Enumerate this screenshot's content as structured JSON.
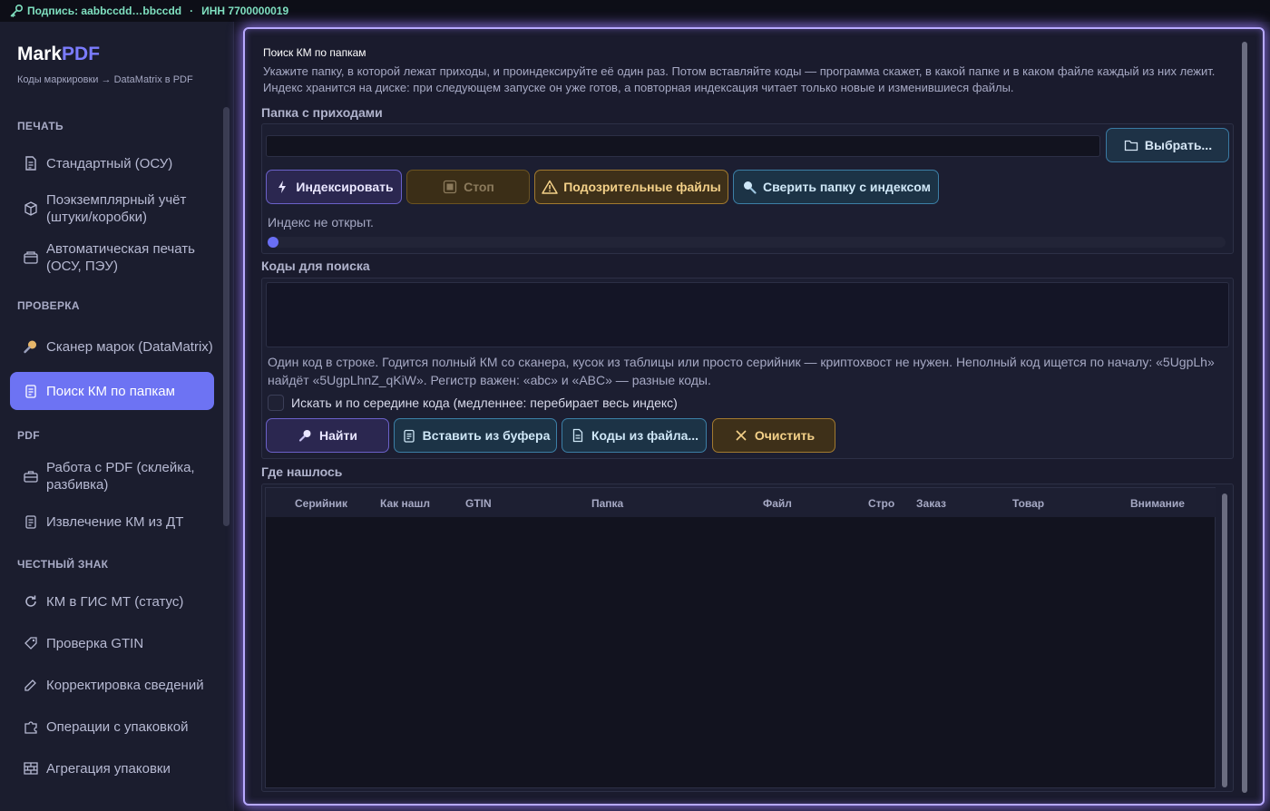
{
  "topbar": {
    "signature": "Подпись: aabbccdd…bbccdd",
    "separator": "·",
    "inn": "ИНН 7700000019"
  },
  "sidebar": {
    "brand_main": "Mark",
    "brand_accent": "PDF",
    "subtitle": "Коды маркировки → DataMatrix в PDF",
    "sections": {
      "print": "ПЕЧАТЬ",
      "check": "ПРОВЕРКА",
      "pdf": "PDF",
      "honest": "ЧЕСТНЫЙ ЗНАК"
    },
    "items": [
      {
        "label": "Стандартный (ОСУ)",
        "icon": "document-icon"
      },
      {
        "label": "Поэкземплярный учёт (штуки/коробки)",
        "icon": "box-icon"
      },
      {
        "label": "Автоматическая печать (ОСУ, ПЭУ)",
        "icon": "printer-icon"
      },
      {
        "label": "Сканер марок (DataMatrix)",
        "icon": "magnifier-icon"
      },
      {
        "label": "Поиск КМ по папкам",
        "icon": "clipboard-icon",
        "active": true
      },
      {
        "label": "Работа с PDF (склейка, разбивка)",
        "icon": "briefcase-icon"
      },
      {
        "label": "Извлечение КМ из ДТ",
        "icon": "clipboard-icon"
      },
      {
        "label": "КМ в ГИС МТ (статус)",
        "icon": "refresh-icon"
      },
      {
        "label": "Проверка GTIN",
        "icon": "tag-icon"
      },
      {
        "label": "Корректировка сведений",
        "icon": "pencil-icon"
      },
      {
        "label": "Операции с упаковкой",
        "icon": "puzzle-icon"
      },
      {
        "label": "Агрегация упаковки",
        "icon": "bricks-icon"
      }
    ]
  },
  "main": {
    "title": "Поиск КМ по папкам",
    "description": "Укажите папку, в которой лежат приходы, и проиндексируйте её один раз. Потом вставляйте коды — программа скажет, в какой папке и в каком файле каждый из них лежит. Индекс хранится на диске: при следующем запуске он уже готов, а повторная индексация читает только новые и изменившиеся файлы.",
    "folder_group": {
      "label": "Папка с приходами",
      "path_value": "",
      "choose_button": "Выбрать...",
      "index_button": "Индексировать",
      "stop_button": "Стоп",
      "suspicious_button": "Подозрительные файлы",
      "verify_button": "Сверить папку с индексом",
      "status": "Индекс не открыт.",
      "progress": 0
    },
    "codes_group": {
      "label": "Коды для поиска",
      "codes_value": "",
      "help": "Один код в строке. Годится полный КМ со сканера, кусок из таблицы или просто серийник — криптохвост не нужен. Неполный код ищется по началу: «5UgpLh» найдёт «5UgpLhnZ_qKiW». Регистр важен: «abc» и «ABC» — разные коды.",
      "checkbox_label": "Искать и по середине кода (медленнее: перебирает весь индекс)",
      "checkbox_checked": false,
      "find_button": "Найти",
      "paste_button": "Вставить из буфера",
      "file_button": "Коды из файла...",
      "clear_button": "Очистить"
    },
    "results": {
      "label": "Где нашлось",
      "columns": [
        "Серийник",
        "Как нашл",
        "GTIN",
        "Папка",
        "Файл",
        "Строі",
        "Заказ",
        "Товар",
        "Внимание"
      ],
      "rows": []
    }
  },
  "colors": {
    "accent": "#6d73f3",
    "frame_glow": "#b7a9ff",
    "amber": "#f4d189",
    "teal": "#3c7fa6"
  }
}
